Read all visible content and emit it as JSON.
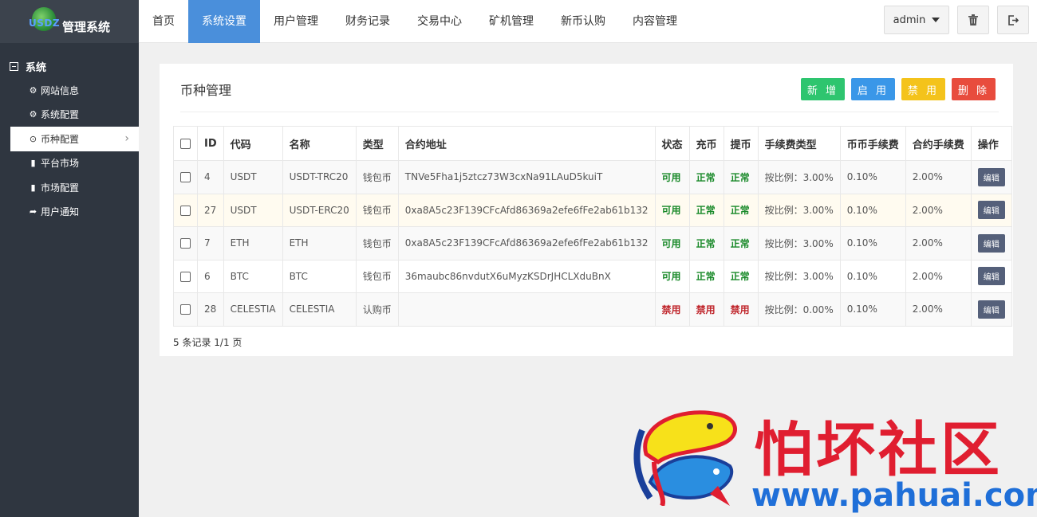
{
  "brand": {
    "logo_text": "USDZ",
    "title": "管理系统"
  },
  "sidebar": {
    "group": "系统",
    "items": [
      {
        "label": "网站信息",
        "icon": "gear-icon"
      },
      {
        "label": "系统配置",
        "icon": "gear-icon"
      },
      {
        "label": "币种配置",
        "icon": "circle-dot-icon",
        "active": true
      },
      {
        "label": "平台市场",
        "icon": "bar-chart-icon"
      },
      {
        "label": "市场配置",
        "icon": "bar-chart-icon"
      },
      {
        "label": "用户通知",
        "icon": "share-icon"
      }
    ]
  },
  "topnav": {
    "items": [
      "首页",
      "系统设置",
      "用户管理",
      "财务记录",
      "交易中心",
      "矿机管理",
      "新币认购",
      "内容管理"
    ],
    "active_index": 1,
    "user": "admin"
  },
  "panel": {
    "title": "币种管理",
    "buttons": {
      "add": "新 增",
      "enable": "启 用",
      "disable": "禁 用",
      "delete": "删 除"
    },
    "columns": [
      "ID",
      "代码",
      "名称",
      "类型",
      "合约地址",
      "状态",
      "充币",
      "提币",
      "手续费类型",
      "币币手续费",
      "合约手续费",
      "操作"
    ],
    "rows": [
      {
        "id": "4",
        "code": "USDT",
        "name": "USDT-TRC20",
        "type": "钱包币",
        "address": "TNVe5Fha1j5ztcz73W3cxNa91LAuD5kuiT",
        "status": "可用",
        "deposit": "正常",
        "withdraw": "正常",
        "fee_type": "按比例：3.00%",
        "spot_fee": "0.10%",
        "contract_fee": "2.00%",
        "action": "编辑"
      },
      {
        "id": "27",
        "code": "USDT",
        "name": "USDT-ERC20",
        "type": "钱包币",
        "address": "0xa8A5c23F139CFcAfd86369a2efe6fFe2ab61b132",
        "status": "可用",
        "deposit": "正常",
        "withdraw": "正常",
        "fee_type": "按比例：3.00%",
        "spot_fee": "0.10%",
        "contract_fee": "2.00%",
        "action": "编辑"
      },
      {
        "id": "7",
        "code": "ETH",
        "name": "ETH",
        "type": "钱包币",
        "address": "0xa8A5c23F139CFcAfd86369a2efe6fFe2ab61b132",
        "status": "可用",
        "deposit": "正常",
        "withdraw": "正常",
        "fee_type": "按比例：3.00%",
        "spot_fee": "0.10%",
        "contract_fee": "2.00%",
        "action": "编辑"
      },
      {
        "id": "6",
        "code": "BTC",
        "name": "BTC",
        "type": "钱包币",
        "address": "36maubc86nvdutX6uMyzKSDrJHCLXduBnX",
        "status": "可用",
        "deposit": "正常",
        "withdraw": "正常",
        "fee_type": "按比例：3.00%",
        "spot_fee": "0.10%",
        "contract_fee": "2.00%",
        "action": "编辑"
      },
      {
        "id": "28",
        "code": "CELESTIA",
        "name": "CELESTIA",
        "type": "认购币",
        "address": "",
        "status": "禁用",
        "deposit": "禁用",
        "withdraw": "禁用",
        "fee_type": "按比例：0.00%",
        "spot_fee": "0.10%",
        "contract_fee": "2.00%",
        "action": "编辑"
      }
    ],
    "records": "5 条记录 1/1 页"
  },
  "watermark": {
    "title": "怕坏社区",
    "url": "www.pahuai.com"
  },
  "colors": {
    "sidebar": "#2f3640",
    "nav_active": "#4a8fdb",
    "ok": "#1a8a2a",
    "disabled": "#c0272d"
  }
}
